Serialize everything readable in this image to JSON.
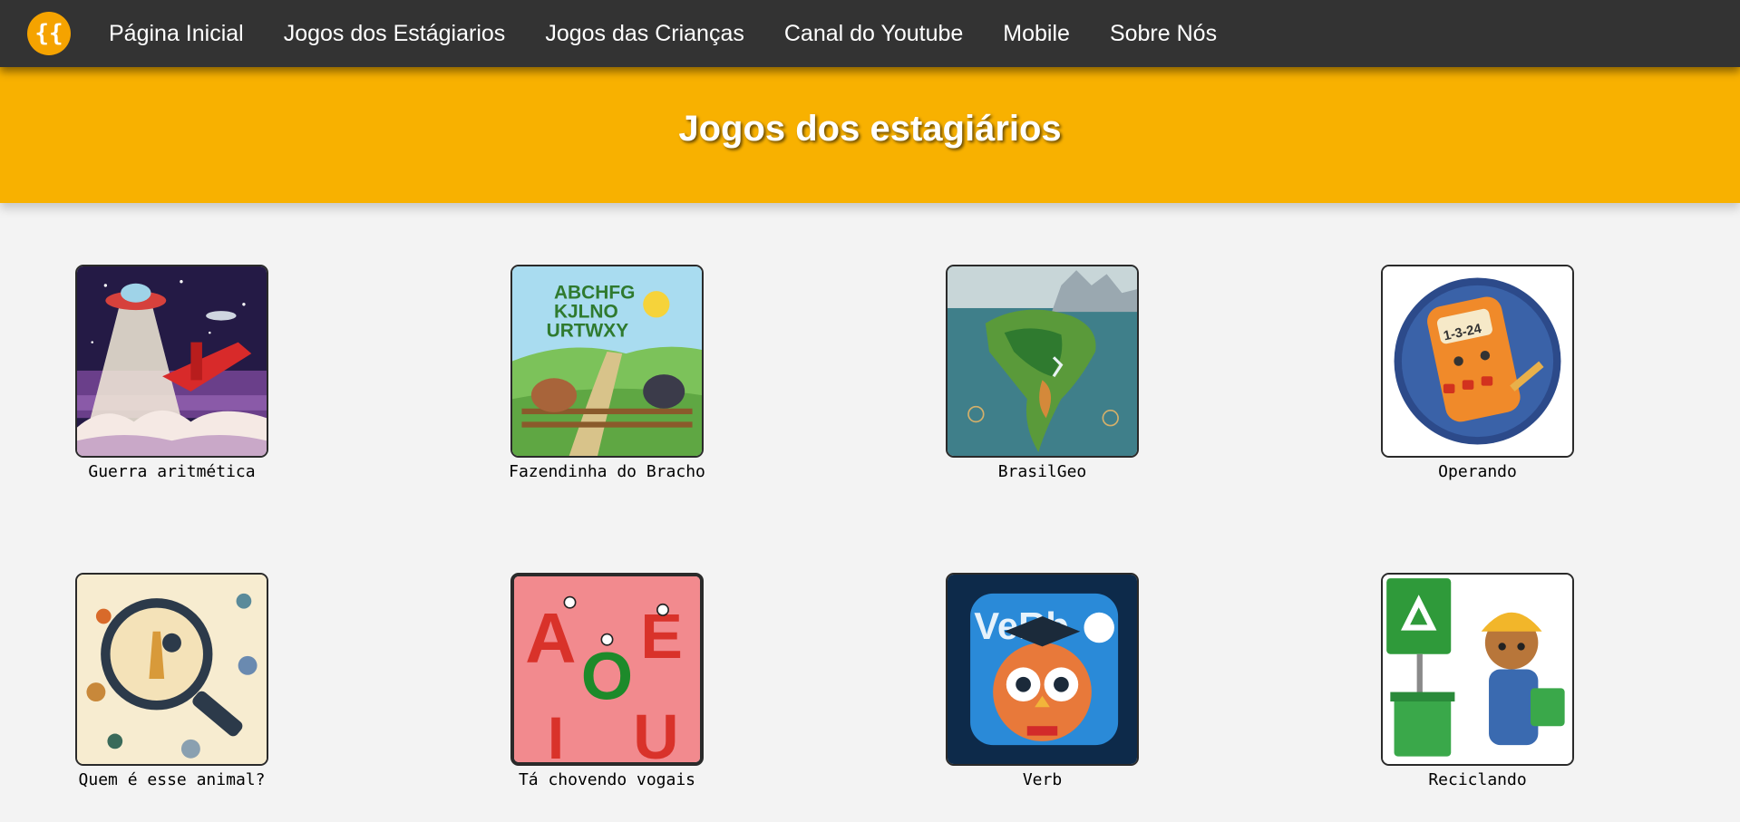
{
  "nav": {
    "logo_text": "{{",
    "links": [
      "Página Inicial",
      "Jogos dos Estágiarios",
      "Jogos das Crianças",
      "Canal do Youtube",
      "Mobile",
      "Sobre Nós"
    ]
  },
  "banner": {
    "title": "Jogos dos estagiários"
  },
  "games": [
    {
      "title": "Guerra aritmética",
      "art": "spaceship-war-art"
    },
    {
      "title": "Fazendinha do Bracho",
      "art": "farm-alphabet-art",
      "art_text": [
        "ABCHFG",
        "KJLNO",
        "URTWXY"
      ]
    },
    {
      "title": "BrasilGeo",
      "art": "south-america-map-art"
    },
    {
      "title": "Operando",
      "art": "calculator-art",
      "art_text": "1-3-24"
    },
    {
      "title": "Quem é esse animal?",
      "art": "magnifier-animals-art"
    },
    {
      "title": "Tá chovendo vogais",
      "art": "vowels-art",
      "art_text": [
        "A",
        "E",
        "O",
        "I",
        "U"
      ]
    },
    {
      "title": "Verb",
      "art": "owl-verb-art",
      "art_text": "VeRb"
    },
    {
      "title": "Reciclando",
      "art": "recycling-bear-art"
    }
  ],
  "colors": {
    "nav_bg": "#333333",
    "accent": "#f8b100",
    "logo": "#f5a300",
    "page_bg": "#f3f3f3"
  }
}
